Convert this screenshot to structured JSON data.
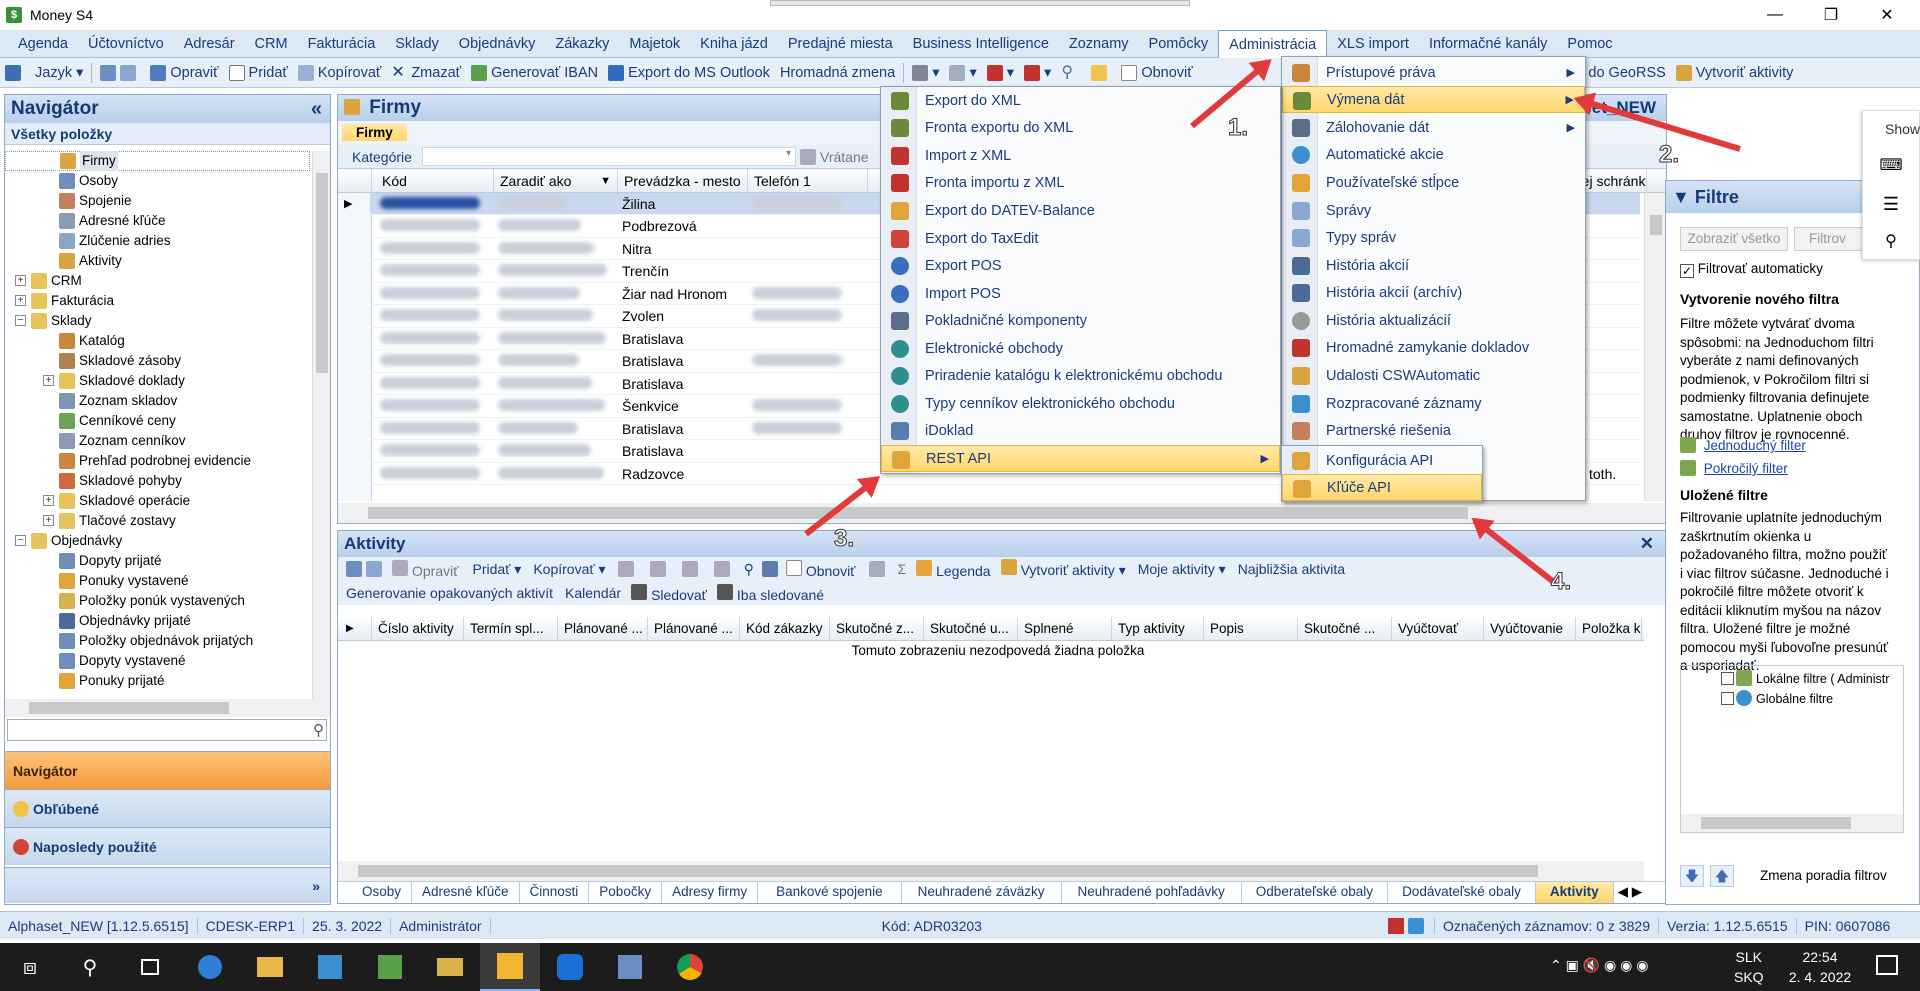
{
  "window": {
    "title": "Money S4"
  },
  "menubar": [
    "Agenda",
    "Účtovníctvo",
    "Adresár",
    "CRM",
    "Fakturácia",
    "Sklady",
    "Objednávky",
    "Zákazky",
    "Majetok",
    "Kniha jázd",
    "Predajné miesta",
    "Business Intelligence",
    "Zoznamy",
    "Pomôcky",
    "Administrácia",
    "XLS import",
    "Informačné kanály",
    "Pomoc"
  ],
  "toolbar": {
    "jazyk": "Jazyk",
    "opravit": "Opraviť",
    "pridat": "Pridať",
    "kopirovat": "Kopírovať",
    "zmazat": "Zmazať",
    "generovat_iban": "Generovať IBAN",
    "export_outlook": "Export do MS Outlook",
    "hromadna": "Hromadná zmena",
    "obnovit": "Obnoviť",
    "geo": "rtovať do GeoRSS",
    "vytvorit": "Vytvoriť aktivity"
  },
  "navigator": {
    "title": "Navigátor",
    "all_items": "Všetky položky",
    "items": [
      "Firmy",
      "Osoby",
      "Spojenie",
      "Adresné kľúče",
      "Zlúčenie adries",
      "Aktivity",
      "CRM",
      "Fakturácia",
      "Sklady",
      "Katalóg",
      "Skladové zásoby",
      "Skladové doklady",
      "Zoznam skladov",
      "Cenníkové ceny",
      "Zoznam cenníkov",
      "Prehľad podrobnej evidencie",
      "Skladové pohyby",
      "Skladové operácie",
      "Tlačové zostavy",
      "Objednávky",
      "Dopyty prijaté",
      "Ponuky vystavené",
      "Položky ponúk vystavených",
      "Objednávky prijaté",
      "Položky objednávok prijatých",
      "Dopyty vystavené",
      "Ponuky prijaté"
    ],
    "buttons": [
      "Navigátor",
      "Obľúbené",
      "Naposledy použité"
    ]
  },
  "firmy": {
    "title": "Firmy",
    "tab": "Firmy",
    "kategorie": "Kategórie",
    "vratane": "Vrátane",
    "company_right": "Alphaset_NEW",
    "columns": [
      "Kód",
      "Zaradiť ako",
      "Prevádzka - mesto",
      "Telefón 1"
    ],
    "right_col": "rej schránky",
    "rows": [
      "Žilina",
      "Podbrezová",
      "Nitra",
      "Trenčín",
      "Žiar nad Hronom",
      "Zvolen",
      "Bratislava",
      "Bratislava",
      "Bratislava",
      "Šenkvice",
      "Bratislava",
      "Bratislava",
      "Radzovce"
    ],
    "last_right": "toth."
  },
  "aktivity": {
    "title": "Aktivity",
    "toolbar": [
      "Opraviť",
      "Pridať",
      "Kopírovať",
      "Obnoviť",
      "Legenda",
      "Vytvoriť aktivity",
      "Moje aktivity",
      "Najbližšia aktivita"
    ],
    "toolbar2": [
      "Generovanie opakovaných aktivít",
      "Kalendár",
      "Sledovať",
      "Iba sledované"
    ],
    "columns": [
      "Číslo aktivity",
      "Termín spl...",
      "Plánované ...",
      "Plánované ...",
      "Kód zákazky",
      "Skutočné z...",
      "Skutočné u...",
      "Splnené",
      "Typ aktivity",
      "Popis",
      "Skutočné ...",
      "Vyúčtovať",
      "Vyúčtovanie",
      "Položka k"
    ],
    "empty": "Tomuto zobrazeniu nezodpovedá žiadna položka",
    "tabs": [
      "Osoby",
      "Adresné kľúče",
      "Činnosti",
      "Pobočky",
      "Adresy firmy",
      "Bankové spojenie",
      "Neuhradené záväzky",
      "Neuhradené pohľadávky",
      "Odberateľské obaly",
      "Dodávateľské obaly",
      "Aktivity"
    ]
  },
  "filtre": {
    "title": "Filtre",
    "show_all": "Zobraziť všetko",
    "filter_btn": "Filtrov",
    "auto": "Filtrovať automaticky",
    "new_title": "Vytvorenie nového filtra",
    "new_text": "Filtre môžete vytvárať dvoma spôsobmi: na Jednoduchom filtri vyberáte z nami definovaných podmienok, v Pokročilom filtri si podmienky filtrovania definujete samostatne. Uplatnenie oboch druhov filtrov je rovnocenné.",
    "simple": "Jednoduchý filter",
    "advanced": "Pokročilý filter",
    "saved_title": "Uložené filtre",
    "saved_text": "Filtrovanie uplatníte jednoduchým zaškrtnutím okienka u požadovaného filtra, možno použiť i viac filtrov súčasne. Jednoduché i pokročilé filtre môžete otvoriť k editácii kliknutím myšou na názov filtra. Uložené filtre je možné pomocou myši ľubovoľne presunúť a usporiadať.",
    "local": "Lokálne filtre ( Administr",
    "global": "Globálne filtre",
    "order": "Zmena poradia filtrov"
  },
  "menu_admin": [
    "Prístupové práva",
    "Výmena dát",
    "Zálohovanie dát",
    "Automatické akcie",
    "Používateľské stĺpce",
    "Správy",
    "Typy správ",
    "História akcií",
    "História akcií (archív)",
    "História aktualizácií",
    "Hromadné zamykanie dokladov",
    "Udalosti CSWAutomatic",
    "Rozpracované záznamy",
    "Partnerské riešenia"
  ],
  "menu_exchange": [
    "Export do XML",
    "Fronta exportu do XML",
    "Import z XML",
    "Fronta importu z XML",
    "Export do DATEV-Balance",
    "Export do TaxEdit",
    "Export POS",
    "Import POS",
    "Pokladničné komponenty",
    "Elektronické obchody",
    "Priradenie katalógu k elektronickému obchodu",
    "Typy cenníkov elektronického obchodu",
    "iDoklad",
    "REST API"
  ],
  "menu_rest": [
    "Konfigurácia API",
    "Kľúče API"
  ],
  "annotations": [
    "1.",
    "2.",
    "3.",
    "4."
  ],
  "side_widget": {
    "show": "Show"
  },
  "status": {
    "db": "Alphaset_NEW [1.12.5.6515]",
    "pc": "CDESK-ERP1",
    "date": "25. 3. 2022",
    "user": "Administrátor",
    "code": "Kód: ADR03203",
    "marked": "Označených záznamov: 0 z 3829",
    "version": "Verzia: 1.12.5.6515",
    "pin": "PIN: 0607086"
  },
  "taskbar": {
    "lang1": "SLK",
    "lang2": "SKQ",
    "time": "22:54",
    "date": "2. 4. 2022"
  }
}
